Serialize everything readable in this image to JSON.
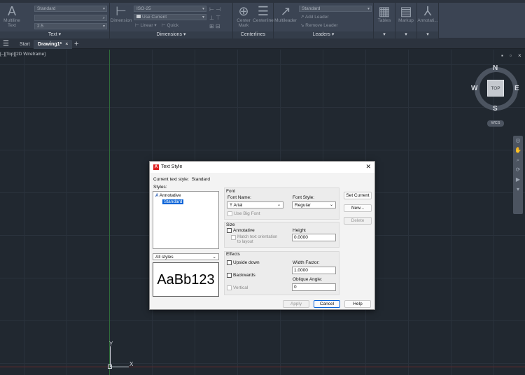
{
  "ribbon": {
    "text_panel": {
      "title": "Text",
      "multiline_text_label": "Multiline\nText",
      "style_value": "Standard",
      "height_value": "2.5"
    },
    "dimensions_panel": {
      "title": "Dimensions",
      "dimension_label": "Dimension",
      "dimstyle_value": "ISO-25",
      "use_current_label": "Use Current",
      "linear_label": "Linear",
      "quick_label": "Quick"
    },
    "centerlines_panel": {
      "title": "Centerlines",
      "center_mark_label": "Center\nMark",
      "centerline_label": "Centerline"
    },
    "leaders_panel": {
      "title": "Leaders",
      "multileader_label": "Multileader",
      "style_value": "Standard",
      "add_leader_label": "Add Leader",
      "remove_leader_label": "Remove Leader"
    },
    "tables_label": "Tables",
    "markup_label": "Markup",
    "annotation_label": "Annotati..."
  },
  "tabs": [
    {
      "label": "Start"
    },
    {
      "label": "Drawing1*"
    }
  ],
  "viewport": {
    "label": "[–][Top][2D Wireframe]",
    "ucs_y": "Y",
    "ucs_x": "X",
    "viewcube": {
      "n": "N",
      "s": "S",
      "e": "E",
      "w": "W",
      "face": "TOP",
      "wcs": "WCS"
    }
  },
  "dialog": {
    "title": "Text Style",
    "current_style_label": "Current text style:",
    "current_style_value": "Standard",
    "styles_label": "Styles:",
    "styles": [
      "Annotative",
      "Standard"
    ],
    "filter_value": "All styles",
    "preview_text": "AaBb123",
    "font": {
      "group_label": "Font",
      "font_name_label": "Font Name:",
      "font_name_value": "Arial",
      "font_style_label": "Font Style:",
      "font_style_value": "Regular",
      "use_big_font_label": "Use Big Font"
    },
    "size": {
      "group_label": "Size",
      "annotative_label": "Annotative",
      "match_orientation_label": "Match text orientation\nto layout",
      "height_label": "Height",
      "height_value": "0.0000"
    },
    "effects": {
      "group_label": "Effects",
      "upside_down_label": "Upside down",
      "backwards_label": "Backwards",
      "vertical_label": "Vertical",
      "width_factor_label": "Width Factor:",
      "width_factor_value": "1.0000",
      "oblique_angle_label": "Oblique Angle:",
      "oblique_angle_value": "0"
    },
    "buttons": {
      "set_current": "Set Current",
      "new": "New...",
      "delete": "Delete",
      "apply": "Apply",
      "cancel": "Cancel",
      "help": "Help"
    }
  }
}
